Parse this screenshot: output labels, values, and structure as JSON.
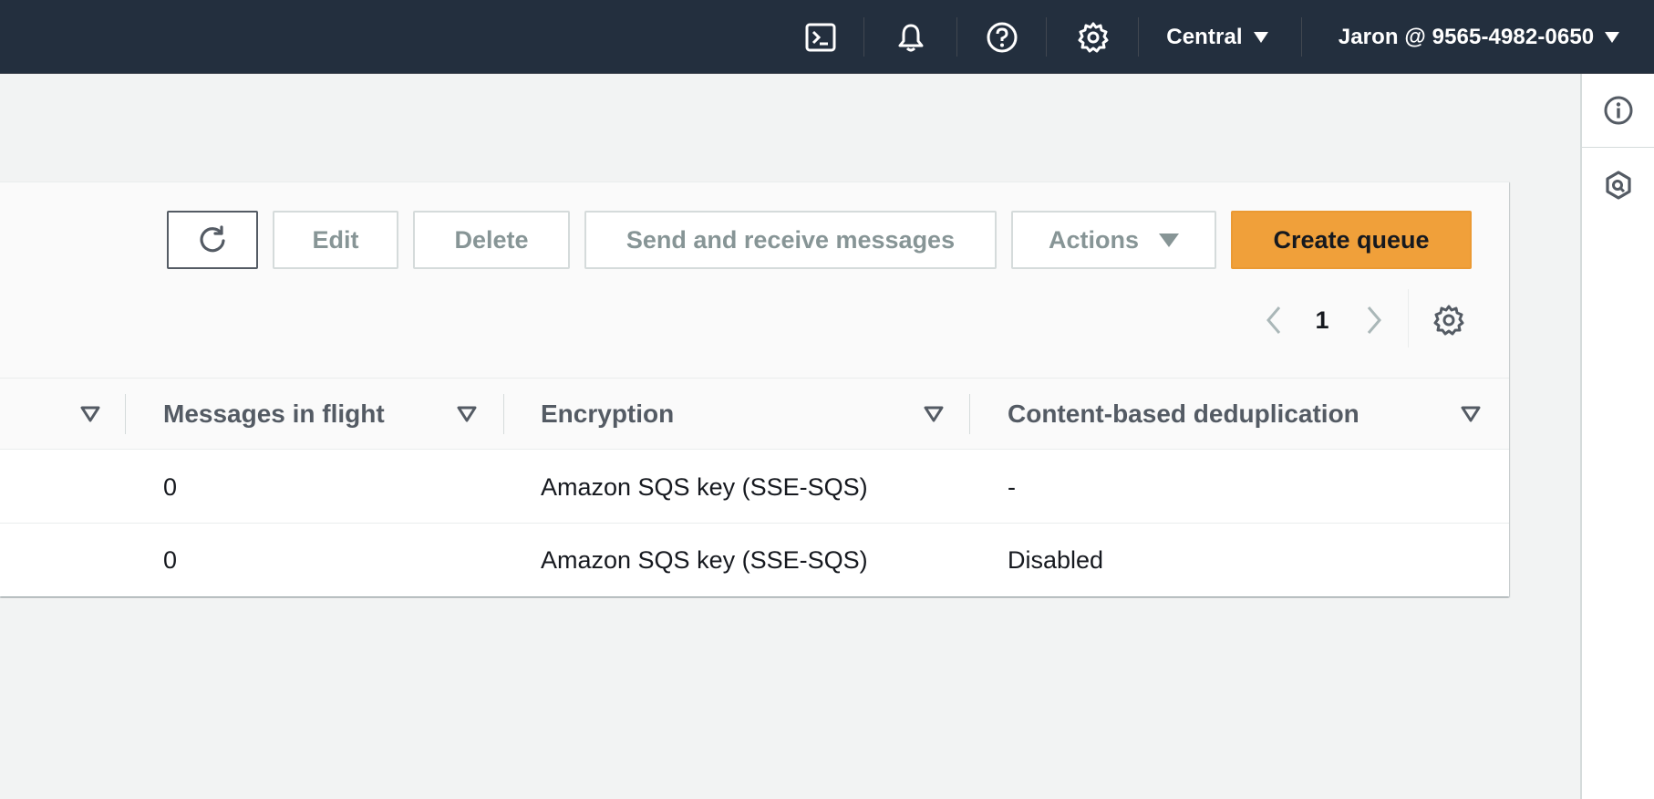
{
  "topnav": {
    "region": "Central",
    "account": "Jaron @ 9565-4982-0650",
    "icons": [
      "cloudshell-icon",
      "bell-icon",
      "help-icon",
      "gear-icon"
    ]
  },
  "toolbar": {
    "edit_label": "Edit",
    "delete_label": "Delete",
    "send_receive_label": "Send and receive messages",
    "actions_label": "Actions",
    "create_label": "Create queue"
  },
  "pagination": {
    "current_page": "1"
  },
  "table": {
    "columns": [
      "Messages in flight",
      "Encryption",
      "Content-based deduplication"
    ],
    "rows": [
      {
        "in_flight": "0",
        "encryption": "Amazon SQS key (SSE-SQS)",
        "dedup": "-"
      },
      {
        "in_flight": "0",
        "encryption": "Amazon SQS key (SSE-SQS)",
        "dedup": "Disabled"
      }
    ]
  },
  "colors": {
    "nav_bg": "#232f3e",
    "primary_button": "#f0a03a",
    "page_bg": "#f2f3f3"
  }
}
